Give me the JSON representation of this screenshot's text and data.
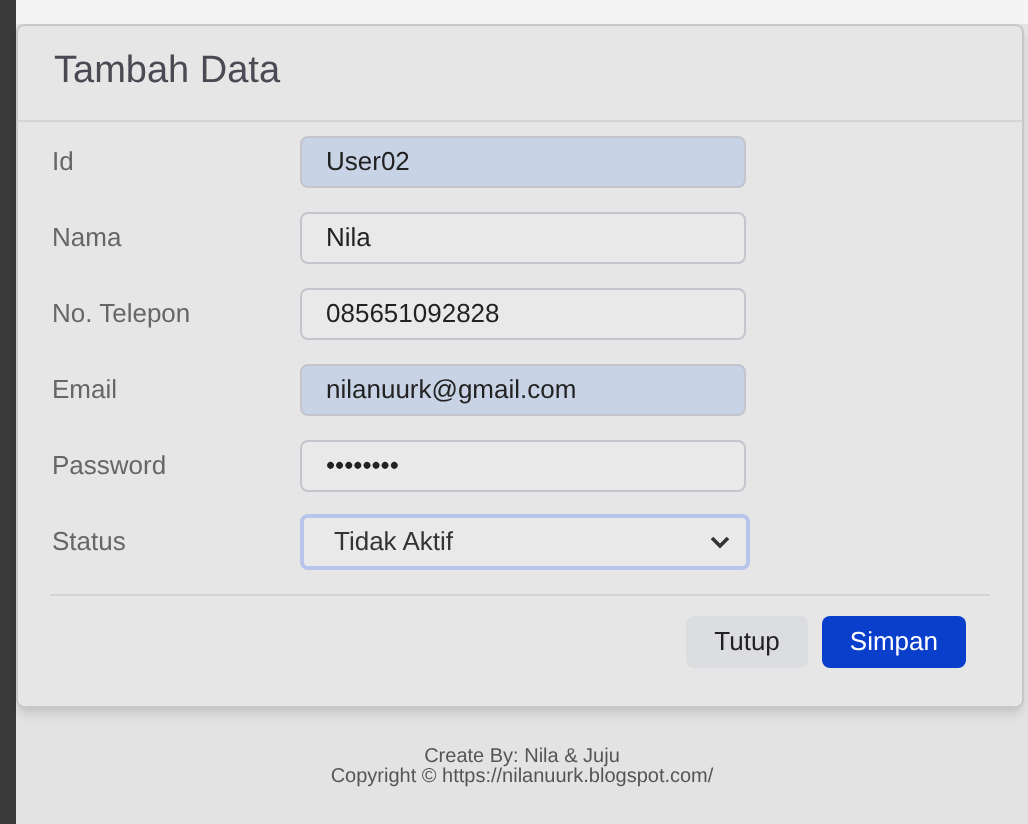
{
  "dialog": {
    "title": "Tambah Data",
    "fields": [
      {
        "kind": "text",
        "label": "Id",
        "value": "User02",
        "highlighted": true
      },
      {
        "kind": "text",
        "label": "Nama",
        "value": "Nila",
        "highlighted": false
      },
      {
        "kind": "text",
        "label": "No. Telepon",
        "value": "085651092828",
        "highlighted": false
      },
      {
        "kind": "text",
        "label": "Email",
        "value": "nilanuurk@gmail.com",
        "highlighted": true
      },
      {
        "kind": "password",
        "label": "Password",
        "value": "••••••••",
        "highlighted": false
      },
      {
        "kind": "select",
        "label": "Status",
        "value": "Tidak Aktif",
        "highlighted": false
      }
    ],
    "buttons": [
      {
        "label": "Tutup",
        "kind": "secondary"
      },
      {
        "label": "Simpan",
        "kind": "primary"
      }
    ]
  },
  "footer": {
    "lines": [
      "Create By: Nila & Juju",
      "Copyright © https://nilanuurk.blogspot.com/"
    ]
  }
}
